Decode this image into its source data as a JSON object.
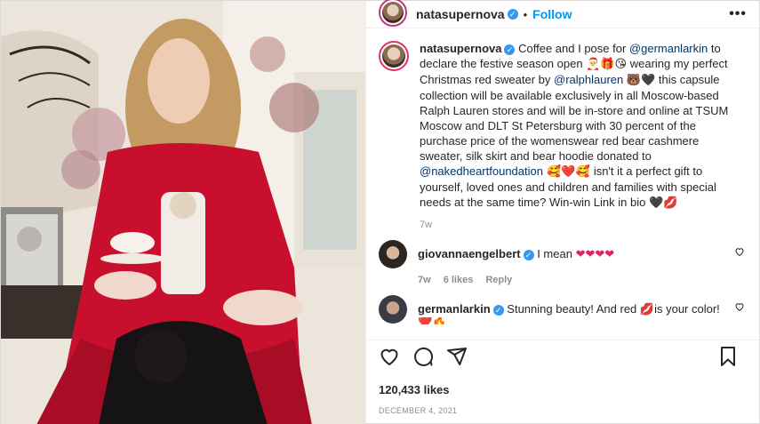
{
  "header": {
    "username": "natasupernova",
    "separator": "•",
    "follow_label": "Follow",
    "more_label": "•••"
  },
  "caption": {
    "username": "natasupernova",
    "segments": {
      "t1": "Coffee and I pose for ",
      "m1": "@germanlarkin",
      "t2": " to declare the festive season open ",
      "e1": "🎅🎁😘",
      "t3": " wearing my perfect Christmas red sweater by ",
      "m2": "@ralphlauren",
      "e2": "🐻🖤",
      "t4": " this capsule collection will be available exclusively in all Moscow-based Ralph Lauren stores and will be in-store and online at TSUM Moscow and DLT St Petersburg with 30 percent of the purchase price of the womenswear red bear cashmere sweater, silk skirt and bear hoodie donated to ",
      "m3": "@nakedheartfoundation",
      "e3": " 🥰❤️🥰 ",
      "t5": "isn't it a perfect gift to yourself, loved ones and children and families with special needs at the same time? Win-win Link in bio ",
      "e4": "🖤💋"
    },
    "time": "7w"
  },
  "comments": [
    {
      "username": "giovannaengelbert",
      "text": "I mean ",
      "emoji": "❤❤❤❤",
      "time": "7w",
      "likes": "6 likes",
      "reply": "Reply"
    },
    {
      "username": "germanlarkin",
      "text": "Stunning beauty! And red ",
      "emoji": "💋",
      "text2": "is your color!",
      "trailing": "❤️🔥"
    }
  ],
  "likes": "120,433 likes",
  "date": "DECEMBER 4, 2021",
  "icons": [
    "more-icon",
    "verified-icon",
    "heart-icon",
    "comment-icon",
    "share-icon",
    "save-icon"
  ],
  "colors": {
    "follow": "#0095f6",
    "mention": "#00376b",
    "verified": "#3897f0",
    "sweater": "#c8102e"
  }
}
